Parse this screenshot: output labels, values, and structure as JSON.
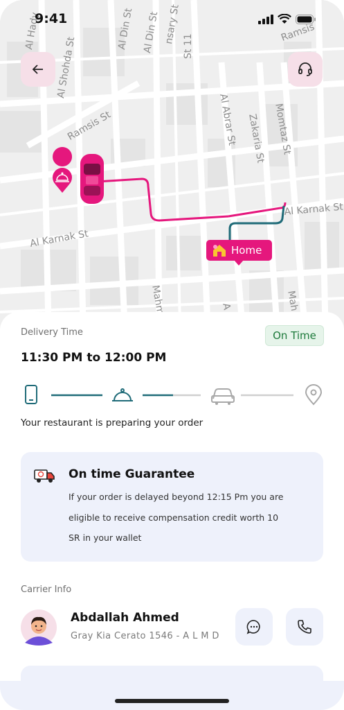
{
  "status_bar": {
    "time": "9:41"
  },
  "map": {
    "streets": [
      "Al Hady",
      "Al Shohda St",
      "Al Din St",
      "Al Din St",
      "nsary St",
      "St 11",
      "Ramsis St",
      "Al Abrar St",
      "Zakaria St",
      "Momtaz St",
      "Al Karnak St",
      "Al Karnak St",
      "Mahm",
      "A",
      "Mah",
      "Ramsis"
    ],
    "home_label": "Home",
    "route_color_driver": "#e5177d",
    "route_color_remaining": "#1f6b78"
  },
  "header": {
    "back_icon": "arrow-left-icon",
    "support_icon": "headset-icon"
  },
  "delivery": {
    "label": "Delivery Time",
    "time_range": "11:30 PM to 12:00 PM",
    "status_badge": "On Time",
    "progress_message": "Your restaurant  is preparing your order",
    "steps": [
      "phone-icon",
      "cloche-icon",
      "car-icon",
      "location-pin-icon"
    ]
  },
  "guarantee": {
    "icon": "delivery-truck-icon",
    "title": "On time Guarantee",
    "line1": "If your order is delayed beyond 12:15 Pm you are",
    "line2": "eligible to receive compensation credit worth 10",
    "line3": "SR in your wallet"
  },
  "carrier": {
    "section_label": "Carrier Info",
    "name": "Abdallah Ahmed",
    "vehicle": "Gray  Kia Cerato  1546 - A L M D",
    "chat_icon": "chat-bubble-icon",
    "call_icon": "phone-call-icon"
  },
  "colors": {
    "accent": "#e5177d",
    "teal": "#1f6b78",
    "card_bg": "#eef1fb",
    "success_bg": "#e6f4ea"
  }
}
